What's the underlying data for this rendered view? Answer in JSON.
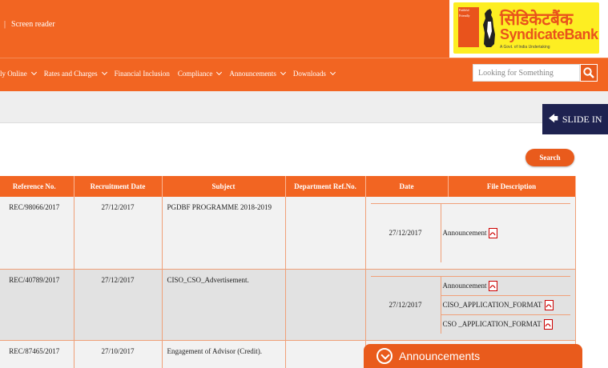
{
  "header": {
    "screen_reader": "Screen reader",
    "logo": {
      "hindi": "सिंडिकेटबैंक",
      "english": "SyndicateBank",
      "tagline": "A Govt. of India Undertaking"
    }
  },
  "nav": {
    "items": [
      {
        "label": "ly Online"
      },
      {
        "label": "Rates and Charges"
      },
      {
        "label": "Financial Inclusion"
      },
      {
        "label": "Compliance"
      },
      {
        "label": "Announcements"
      },
      {
        "label": "Downloads"
      }
    ],
    "search_placeholder": "Looking for Something"
  },
  "slide_in": "SLIDE IN",
  "search_button": "Search",
  "table": {
    "headers": [
      "Reference No.",
      "Recruitment Date",
      "Subject",
      "Department Ref.No.",
      "Date",
      "File Description"
    ],
    "rows": [
      {
        "ref": "REC/98066/2017",
        "recruitment_date": "27/12/2017",
        "subject": "PGDBF PROGRAMME 2018-2019",
        "dept_ref": "",
        "date": "27/12/2017",
        "files": [
          "Announcement"
        ]
      },
      {
        "ref": "REC/40789/2017",
        "recruitment_date": "27/12/2017",
        "subject": "CISO_CSO_Advertisement.",
        "dept_ref": "",
        "date": "27/12/2017",
        "files": [
          "Announcement",
          "CISO_APPLICATION_FORMAT",
          "CSO _APPLICATION_FORMAT"
        ]
      },
      {
        "ref": "REC/87465/2017",
        "recruitment_date": "27/10/2017",
        "subject": "Engagement of Advisor (Credit).",
        "dept_ref": ""
      }
    ]
  },
  "announcements_panel": "Announcements",
  "colors": {
    "brand_orange": "#f26522",
    "navy": "#1e2250"
  }
}
